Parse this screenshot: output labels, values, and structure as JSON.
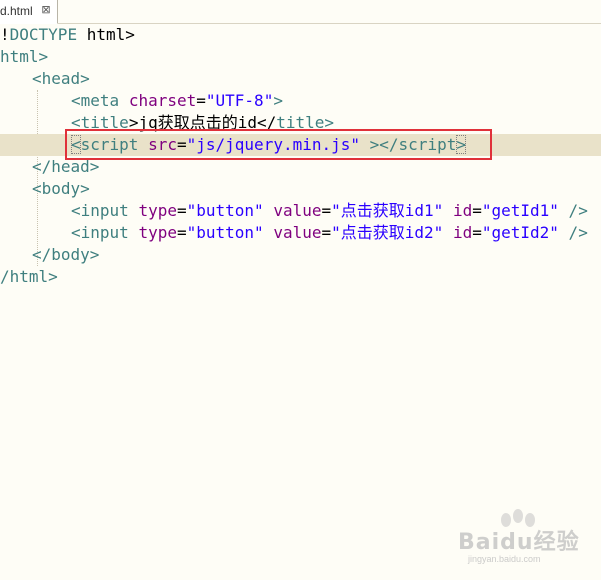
{
  "tab": {
    "title": "d.html",
    "close_glyph": "⊠"
  },
  "code": {
    "l1": {
      "lt": "!",
      "name": "DOCTYPE",
      "rest": " html",
      "gt": ">"
    },
    "l2": {
      "text": "html>"
    },
    "l3": {
      "open": "<",
      "name": "head",
      "close": ">"
    },
    "l4": {
      "open": "<",
      "name": "meta",
      "attr": "charset",
      "eq": "=",
      "val": "\"UTF-8\"",
      "close": ">"
    },
    "l5": {
      "open": "<",
      "name": "title",
      "mid": ">jq获取点击的id</",
      "name2": "title",
      "close": ">"
    },
    "l6": {
      "open": "<",
      "name": "script",
      "attr": "src",
      "eq": "=",
      "val": "\"js/jquery.min.js\"",
      "mid": " ></",
      "name2": "script",
      "close": ">"
    },
    "l7": {
      "open": "</",
      "name": "head",
      "close": ">"
    },
    "l8": {
      "open": "<",
      "name": "body",
      "close": ">"
    },
    "l9": {
      "open": "<",
      "name": "input",
      "a1": "type",
      "v1": "\"button\"",
      "a2": "value",
      "v2": "\"点击获取id1\"",
      "a3": "id",
      "v3": "\"getId1\"",
      "end": " />"
    },
    "l10": {
      "open": "<",
      "name": "input",
      "a1": "type",
      "v1": "\"button\"",
      "a2": "value",
      "v2": "\"点击获取id2\"",
      "a3": "id",
      "v3": "\"getId2\"",
      "end": " />"
    },
    "l11": {
      "open": "</",
      "name": "body",
      "close": ">"
    },
    "l12": {
      "open": "/",
      "name": "html",
      "close": ">"
    }
  },
  "watermark": {
    "brand": "Bai\u0001du经验",
    "url": "jingyan.baidu.com"
  },
  "colors": {
    "tag": "#3f7f7f",
    "attribute": "#7f007f",
    "value": "#2a00ff",
    "current_line": "#e9e2c9",
    "highlight_box": "#e0313a",
    "background": "#fefdf6"
  }
}
